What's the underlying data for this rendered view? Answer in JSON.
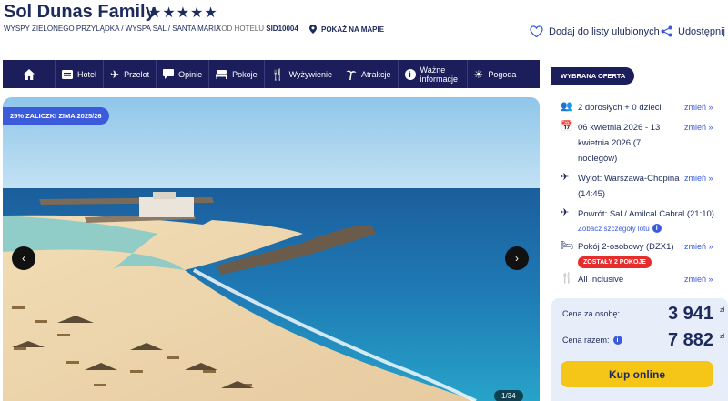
{
  "hotel": {
    "name": "Sol Dunas Family",
    "stars": "★★★★★",
    "location": "WYSPY ZIELONEGO PRZYLĄDKA / WYSPA SAL / SANTA MARIA",
    "code_label": "KOD HOTELU",
    "code": "SID10004",
    "map_link": "POKAŻ NA MAPIE",
    "favorite": "Dodaj do listy ulubionych",
    "share": "Udostępnij"
  },
  "nav": {
    "items": [
      {
        "label": "Hotel",
        "icon": "hotel-icon"
      },
      {
        "label": "Przelot",
        "icon": "plane-icon"
      },
      {
        "label": "Opinie",
        "icon": "comment-icon"
      },
      {
        "label": "Pokoje",
        "icon": "bed-icon"
      },
      {
        "label": "Wyżywienie",
        "icon": "cutlery-icon"
      },
      {
        "label": "Atrakcje",
        "icon": "palm-icon"
      },
      {
        "label": "Ważne informacje",
        "icon": "info-icon"
      },
      {
        "label": "Pogoda",
        "icon": "sun-icon"
      }
    ]
  },
  "gallery": {
    "badge": "25% ZALICZKI ZIMA 2025/26",
    "counter": "1/34"
  },
  "offer": {
    "tag": "WYBRANA OFERTA",
    "change": "zmień »",
    "guests": "2 dorosłych + 0 dzieci",
    "dates": "06 kwietnia 2026 - 13 kwietnia 2026 (7 noclegów)",
    "departure": "Wylot: Warszawa-Chopina (14:45)",
    "return": "Powrót: Sal / Amilcal Cabral (21:10)",
    "flight_details": "Zobacz szczegóły lotu",
    "room": "Pokój 2-osobowy (DZX1)",
    "rooms_left": "ZOSTAŁY 2 POKOJE",
    "board": "All Inclusive"
  },
  "price": {
    "per_person_label": "Cena za osobę:",
    "per_person": "3 941",
    "total_label": "Cena razem:",
    "total": "7 882",
    "currency": "zł",
    "buy": "Kup online"
  },
  "colors": {
    "navy": "#1c1e5c",
    "accent_blue": "#3b5bdb",
    "buy_yellow": "#f5c518",
    "alert_red": "#e52d2d"
  }
}
